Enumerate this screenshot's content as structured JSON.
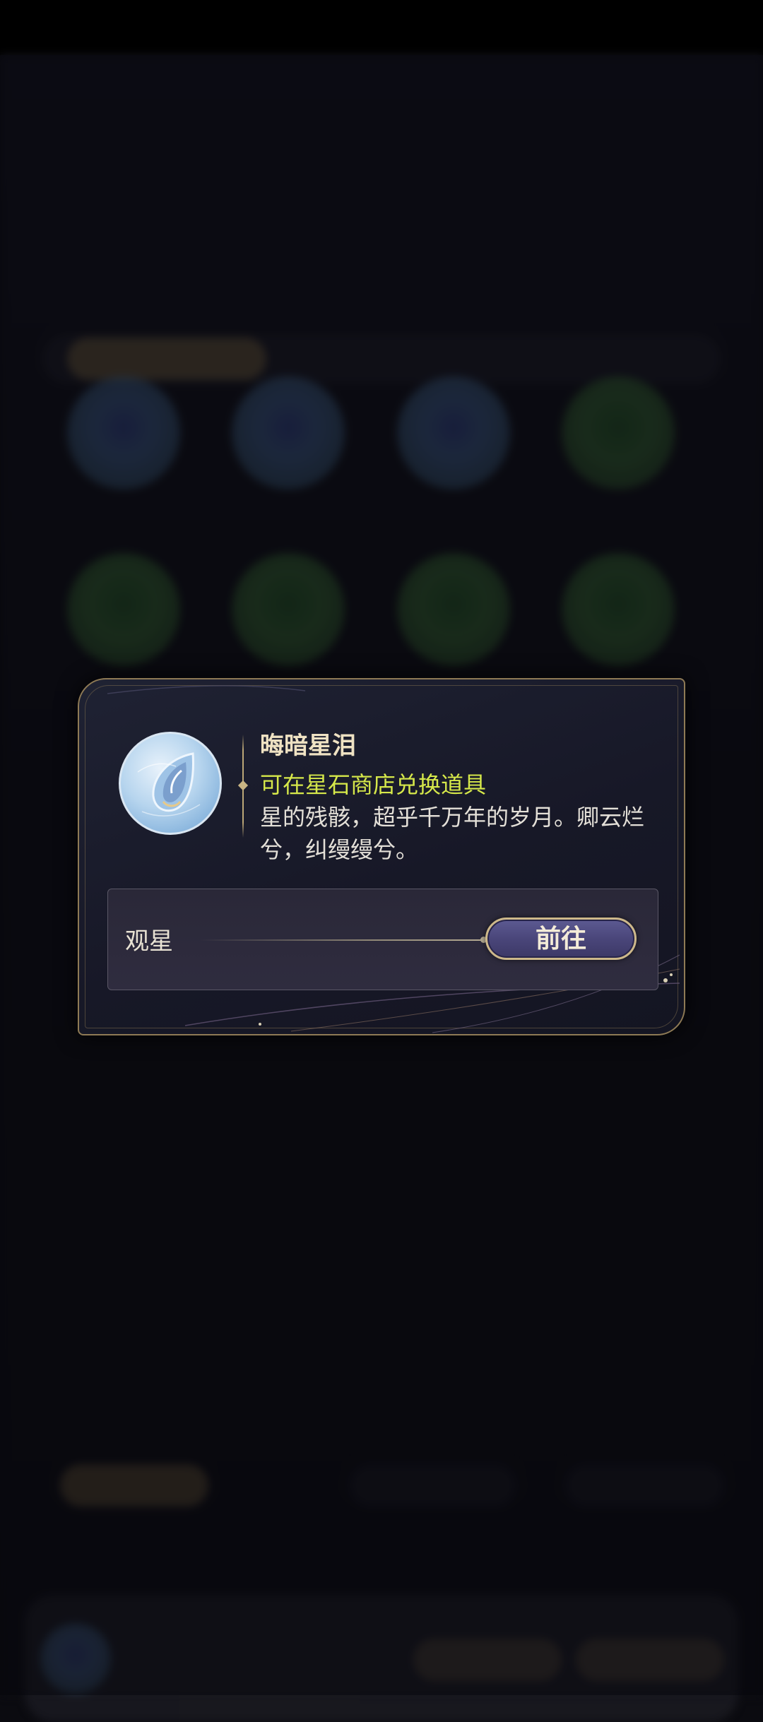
{
  "dialog": {
    "item_name": "晦暗星泪",
    "item_source": "可在星石商店兑换道具",
    "item_description": "星的残骸，超乎千万年的岁月。卿云烂兮，纠缦缦兮。",
    "icon": "star-tear-gem-icon",
    "source_row": {
      "label": "观星",
      "button_label": "前往"
    }
  },
  "colors": {
    "dialog_bg": "#1b1d2c",
    "border_gold": "#8e7a55",
    "item_name_color": "#efe2c3",
    "source_text_color": "#d6e84a",
    "button_purple": "#4a467a"
  }
}
